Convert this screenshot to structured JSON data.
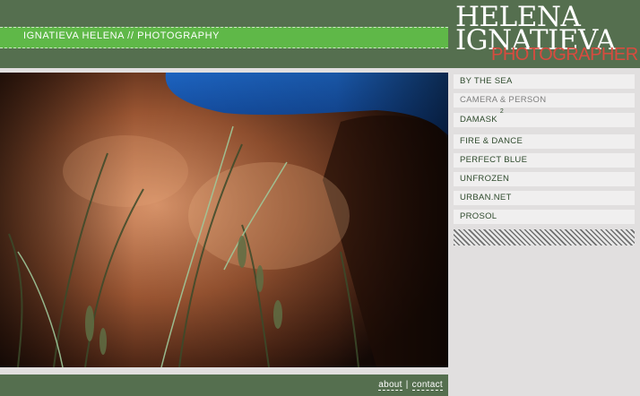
{
  "header": {
    "title_bar": "IGNATIEVA HELENA // PHOTOGRAPHY",
    "logo_line1": "HELENA",
    "logo_line2": "IGNATIEVA",
    "logo_sub": "PHOTOGRAPHER"
  },
  "nav": [
    {
      "label": "BY THE SEA",
      "state": "normal"
    },
    {
      "label": "CAMERA & PERSON",
      "state": "inactive"
    },
    {
      "label": "DAMASK",
      "sup": "2",
      "state": "normal"
    },
    {
      "label": "FIRE & DANCE",
      "state": "normal"
    },
    {
      "label": "PERFECT BLUE",
      "state": "normal"
    },
    {
      "label": "UNFROZEN",
      "state": "normal"
    },
    {
      "label": "URBAN.NET",
      "state": "normal"
    },
    {
      "label": "PROSOL",
      "state": "normal"
    }
  ],
  "footer": {
    "about": "about",
    "separator": "|",
    "contact": "contact"
  },
  "colors": {
    "header_green": "#556f4f",
    "title_bar_green": "#5fb848",
    "logo_red": "#d84b3f",
    "page_bg": "#e1dfdf"
  }
}
